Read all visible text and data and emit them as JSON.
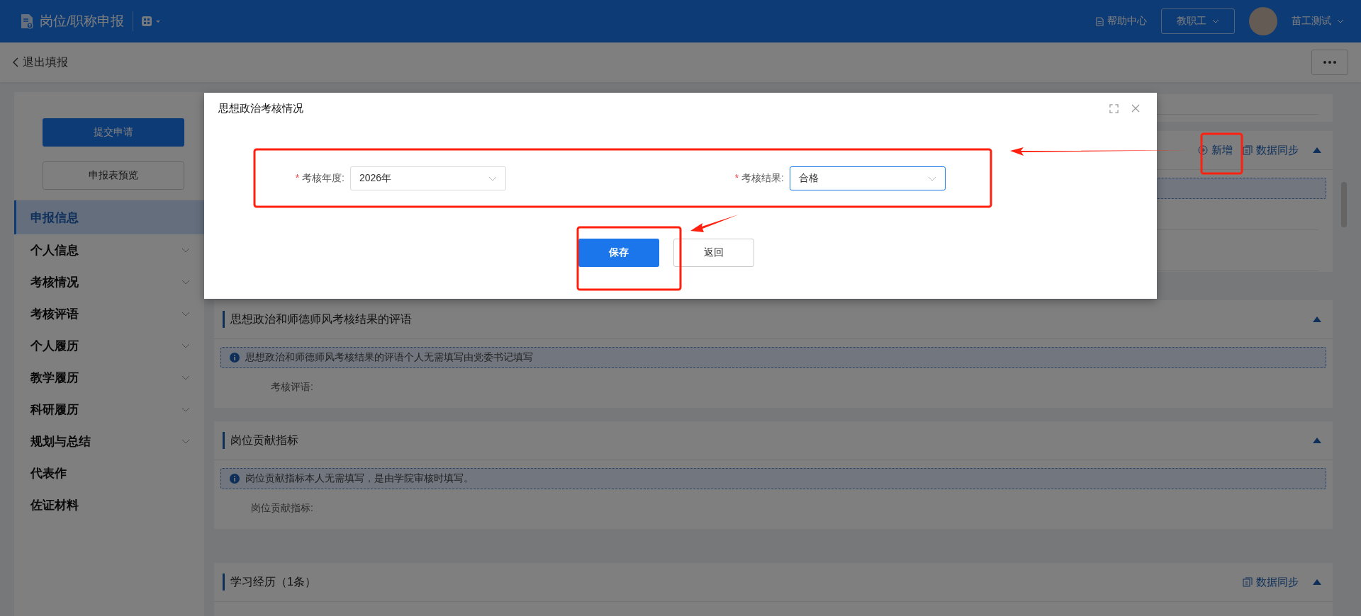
{
  "header": {
    "app_title": "岗位/职称申报",
    "help": "帮助中心",
    "role": "教职工",
    "user": "苗工测试"
  },
  "topbar": {
    "back": "退出填报"
  },
  "sidebar": {
    "submit": "提交申请",
    "preview": "申报表预览",
    "items": [
      {
        "label": "申报信息",
        "selected": true,
        "expandable": false
      },
      {
        "label": "个人信息",
        "selected": false,
        "expandable": true
      },
      {
        "label": "考核情况",
        "selected": false,
        "expandable": true
      },
      {
        "label": "考核评语",
        "selected": false,
        "expandable": true
      },
      {
        "label": "个人履历",
        "selected": false,
        "expandable": true
      },
      {
        "label": "教学履历",
        "selected": false,
        "expandable": true
      },
      {
        "label": "科研履历",
        "selected": false,
        "expandable": true
      },
      {
        "label": "规划与总结",
        "selected": false,
        "expandable": true
      },
      {
        "label": "代表作",
        "selected": false,
        "expandable": false
      },
      {
        "label": "佐证材料",
        "selected": false,
        "expandable": false
      }
    ]
  },
  "records_section": {
    "actions": [
      {
        "kind": "add",
        "label": "新增"
      },
      {
        "kind": "sync",
        "label": "数据同步"
      }
    ]
  },
  "sections": [
    {
      "title": "思想政治和师德师风考核结果的评语",
      "notice": "思想政治和师德师风考核结果的评语个人无需填写由党委书记填写",
      "field_label": "考核评语:"
    },
    {
      "title": "岗位贡献指标",
      "notice": "岗位贡献指标本人无需填写，是由学院审核时填写。",
      "field_label": "岗位贡献指标:"
    },
    {
      "title": "学习经历（1条）",
      "actions": [
        {
          "kind": "sync",
          "label": "数据同步"
        }
      ]
    }
  ],
  "dialog": {
    "title": "思想政治考核情况",
    "fields": [
      {
        "label": "考核年度:",
        "required_mark": "*",
        "value": "2026年",
        "focused": false
      },
      {
        "label": "考核结果:",
        "required_mark": "*",
        "value": "合格",
        "focused": true
      }
    ],
    "buttons": [
      {
        "kind": "primary",
        "label": "保存"
      },
      {
        "kind": "default",
        "label": "返回"
      }
    ]
  }
}
